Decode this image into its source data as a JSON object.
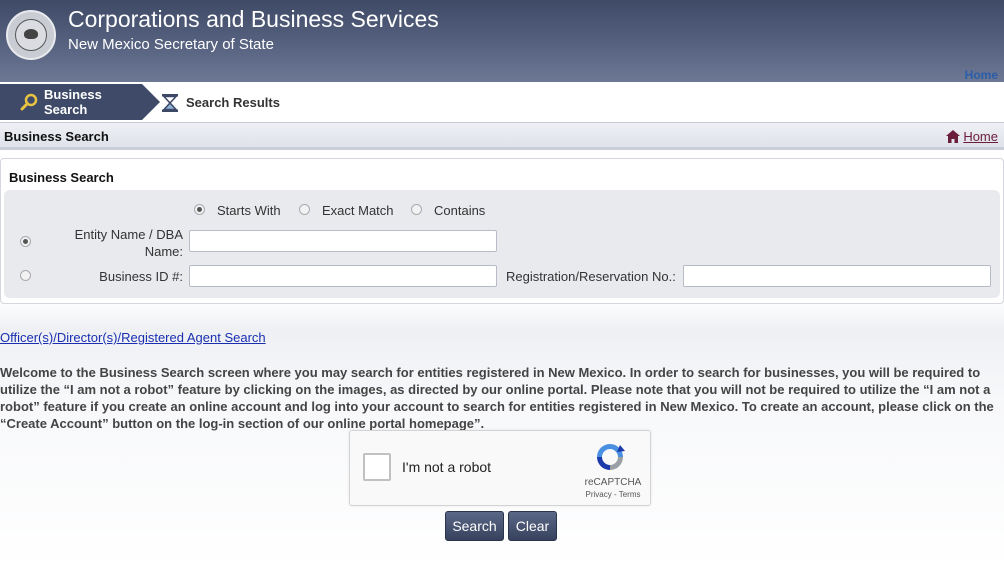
{
  "header": {
    "title": "Corporations and Business Services",
    "subtitle": "New Mexico Secretary of State",
    "home_link": "Home",
    "logo_icon": "state-seal-icon"
  },
  "tabs": [
    {
      "label": "Business Search",
      "icon": "magnifier-icon",
      "active": true
    },
    {
      "label": "Search Results",
      "icon": "hourglass-icon",
      "active": false
    }
  ],
  "breadcrumb": {
    "title": "Business Search",
    "home_label": "Home",
    "home_icon": "house-icon"
  },
  "search_panel": {
    "title": "Business Search",
    "match_options": [
      {
        "label": "Starts With",
        "selected": true
      },
      {
        "label": "Exact Match",
        "selected": false
      },
      {
        "label": "Contains",
        "selected": false
      }
    ],
    "entity_name_label": "Entity Name / DBA Name:",
    "entity_name_value": "",
    "entity_selected": true,
    "business_id_label": "Business ID #:",
    "business_id_value": "",
    "business_id_selected": false,
    "registration_label": "Registration/Reservation No.:",
    "registration_value": ""
  },
  "officer_link": "Officer(s)/Director(s)/Registered Agent Search",
  "welcome_text": "Welcome to the Business Search screen where you may search for entities registered in New Mexico. In order to search for businesses, you will be required to utilize the “I am not a robot” feature by clicking on the images, as directed by our online portal. Please note that you will not be required to utilize the “I am not a robot” feature if you create an online account and log into your account to search for entities registered in New Mexico. To create an account, please click on the “Create Account” button on the log-in section of our online portal homepage”.",
  "captcha": {
    "label": "I'm not a robot",
    "brand": "reCAPTCHA",
    "terms": "Privacy - Terms",
    "checked": false
  },
  "buttons": {
    "search": "Search",
    "clear": "Clear"
  },
  "colors": {
    "header_bg": "#3e4a66",
    "active_tab": "#3e4a68",
    "link": "#1a2fb0",
    "home_link": "#6b1e3a"
  }
}
